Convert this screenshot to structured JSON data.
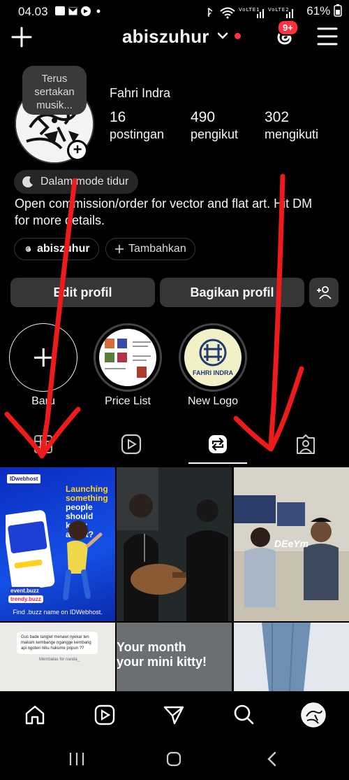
{
  "status_bar": {
    "time": "04.03",
    "left_icons": [
      "photo-icon",
      "gmail-icon",
      "record-icon",
      "dot"
    ],
    "network_label_1": "VoLTE1",
    "network_label_2": "VoLTE2",
    "battery": "61%"
  },
  "header": {
    "username": "abiszuhur",
    "notification_badge": "9+"
  },
  "profile": {
    "note": "Terus sertakan musik...",
    "full_name": "Fahri Indra",
    "stats": [
      {
        "value": "16",
        "label": "postingan"
      },
      {
        "value": "490",
        "label": "pengikut"
      },
      {
        "value": "302",
        "label": "mengikuti"
      }
    ],
    "sleep_mode": "Dalam mode tidur",
    "bio": "Open commission/order for vector and flat art. Hit DM for more details.",
    "threads_chip": "abiszuhur",
    "add_chip": "Tambahkan"
  },
  "actions": {
    "edit": "Edit profil",
    "share": "Bagikan profil"
  },
  "highlights": [
    {
      "label": "Baru"
    },
    {
      "label": "Price List"
    },
    {
      "label": "New Logo",
      "logo_text": "FAHRI INDRA"
    }
  ],
  "grid": {
    "promo": {
      "tag": "IDwebhost",
      "headline_1": "Launching something",
      "headline_2": "people should know about?",
      "brand_1": "event.buzz",
      "brand_2": "trendy.buzz",
      "footer": "Find .buzz name on IDWebhost."
    },
    "gus_post": {
      "text": "Gus bade tanglet menawi nyekar ten makam kembange ngangge kembang api ngoten niku hukume pripun ??",
      "reply": "Membalas for nanda_"
    },
    "kitty_post": {
      "text_1": "Your month",
      "text_2": "your mini kitty!"
    },
    "deeym_post": {
      "overlay": "DEeYm"
    }
  },
  "colors": {
    "background": "#000000",
    "button": "#363636",
    "accent_red": "#ff3040",
    "arrow_red": "#ee1b1b"
  }
}
